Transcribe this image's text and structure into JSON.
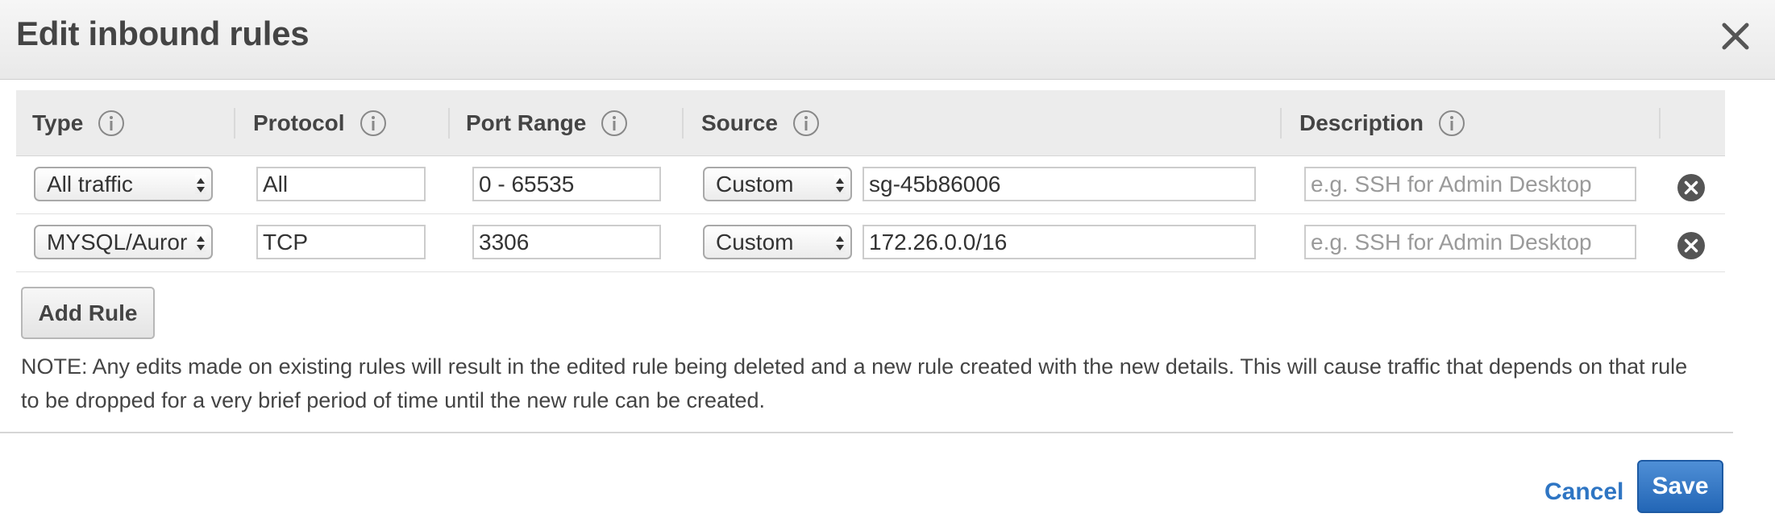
{
  "dialog": {
    "title": "Edit inbound rules"
  },
  "columns": {
    "type": "Type",
    "protocol": "Protocol",
    "port_range": "Port Range",
    "source": "Source",
    "description": "Description"
  },
  "rules": [
    {
      "type": "All traffic",
      "protocol": "All",
      "port_range": "0 - 65535",
      "source_type": "Custom",
      "source_value": "sg-45b86006",
      "description": "",
      "description_placeholder": "e.g. SSH for Admin Desktop"
    },
    {
      "type": "MYSQL/Auror",
      "protocol": "TCP",
      "port_range": "3306",
      "source_type": "Custom",
      "source_value": "172.26.0.0/16",
      "description": "",
      "description_placeholder": "e.g. SSH for Admin Desktop"
    }
  ],
  "actions": {
    "add_rule": "Add Rule",
    "cancel": "Cancel",
    "save": "Save"
  },
  "note": "NOTE: Any edits made on existing rules will result in the edited rule being deleted and a new rule created with the new details. This will cause traffic that depends on that rule to be dropped for a very brief period of time until the new rule can be created.",
  "icons": {
    "close": "close-icon",
    "info": "info-icon",
    "remove": "remove-rule-icon",
    "select_arrows": "select-arrows-icon"
  },
  "colors": {
    "primary_button": "#2e6fbf",
    "link": "#2e75c3",
    "remove_icon": "#555555"
  }
}
